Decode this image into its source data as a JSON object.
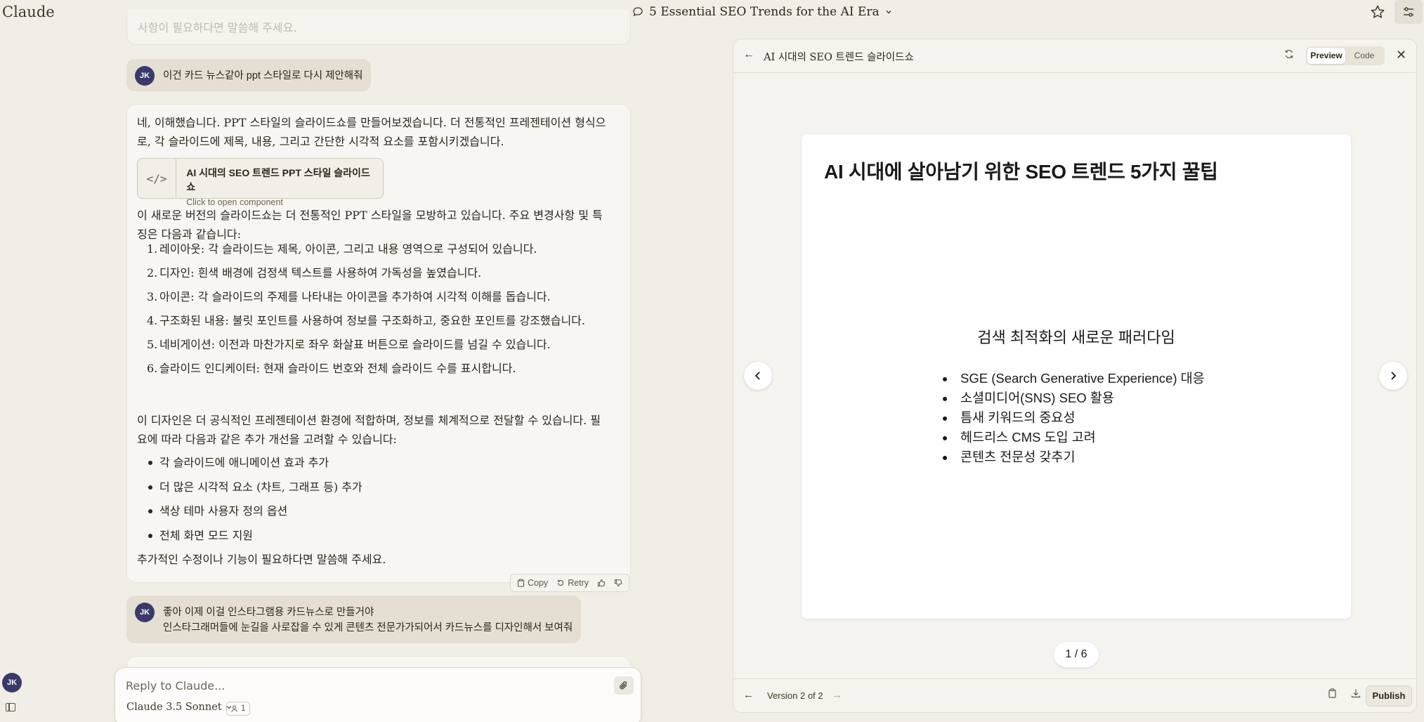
{
  "app": {
    "logo": "Claude"
  },
  "header": {
    "chat_title": "5 Essential SEO Trends for the AI Era"
  },
  "user": {
    "initials": "JK"
  },
  "chat": {
    "prev_message_fragment": "사항이 필요하다면 말씀해 주세요.",
    "user_message_1": "이건 카드 뉴스같아 ppt 스타일로 다시 제안해줘",
    "assistant": {
      "intro": "네, 이해했습니다. PPT 스타일의 슬라이드쇼를 만들어보겠습니다. 더 전통적인 프레젠테이션 형식으로, 각 슬라이드에 제목, 내용, 그리고 간단한 시각적 요소를 포함시키겠습니다.",
      "artifact": {
        "icon_glyph": "</>",
        "title": "AI 시대의 SEO 트렌드 PPT 스타일 슬라이드쇼",
        "subtitle": "Click to open component"
      },
      "para2": "이 새로운 버전의 슬라이드쇼는 더 전통적인 PPT 스타일을 모방하고 있습니다. 주요 변경사항 및 특징은 다음과 같습니다:",
      "steps": [
        {
          "num": "1.",
          "text": "레이아웃: 각 슬라이드는 제목, 아이콘, 그리고 내용 영역으로 구성되어 있습니다."
        },
        {
          "num": "2.",
          "text": "디자인: 흰색 배경에 검정색 텍스트를 사용하여 가독성을 높였습니다."
        },
        {
          "num": "3.",
          "text": "아이콘: 각 슬라이드의 주제를 나타내는 아이콘을 추가하여 시각적 이해를 돕습니다."
        },
        {
          "num": "4.",
          "text": "구조화된 내용: 불릿 포인트를 사용하여 정보를 구조화하고, 중요한 포인트를 강조했습니다."
        },
        {
          "num": "5.",
          "text": "네비게이션: 이전과 마찬가지로 좌우 화살표 버튼으로 슬라이드를 넘길 수 있습니다."
        },
        {
          "num": "6.",
          "text": "슬라이드 인디케이터: 현재 슬라이드 번호와 전체 슬라이드 수를 표시합니다."
        }
      ],
      "para3": "이 디자인은 더 공식적인 프레젠테이션 환경에 적합하며, 정보를 체계적으로 전달할 수 있습니다. 필요에 따라 다음과 같은 추가 개선을 고려할 수 있습니다:",
      "bullets": [
        "각 슬라이드에 애니메이션 효과 추가",
        "더 많은 시각적 요소 (차트, 그래프 등) 추가",
        "색상 테마 사용자 정의 옵션",
        "전체 화면 모드 지원"
      ],
      "closing": "추가적인 수정이나 기능이 필요하다면 말씀해 주세요."
    },
    "actions": {
      "copy": "Copy",
      "retry": "Retry"
    },
    "user_message_2": {
      "line1": "좋아 이제 이걸 인스타그램용 카드뉴스로 만들거야",
      "line2": "인스타그래머들에 눈길을 사로잡을 수 있게 콘텐츠 전문가가되어서 카드뉴스를 디자인해서 보여줘"
    }
  },
  "composer": {
    "placeholder": "Reply to Claude...",
    "model": "Claude 3.5 Sonnet",
    "project_count": "1"
  },
  "artifact_panel": {
    "title": "AI 시대의 SEO 트렌드 슬라이드쇼",
    "tabs": {
      "preview": "Preview",
      "code": "Code"
    },
    "slide": {
      "title": "AI 시대에 살아남기 위한 SEO 트렌드 5가지 꿀팁",
      "subtitle": "검색 최적화의 새로운 패러다임",
      "items": [
        "SGE (Search Generative Experience) 대응",
        "소셜미디어(SNS) SEO 활용",
        "틈새 키워드의 중요성",
        "헤드리스 CMS 도입 고려",
        "콘텐츠 전문성 갖추기"
      ]
    },
    "page_indicator": "1 / 6",
    "version": "Version 2 of 2",
    "publish": "Publish"
  }
}
